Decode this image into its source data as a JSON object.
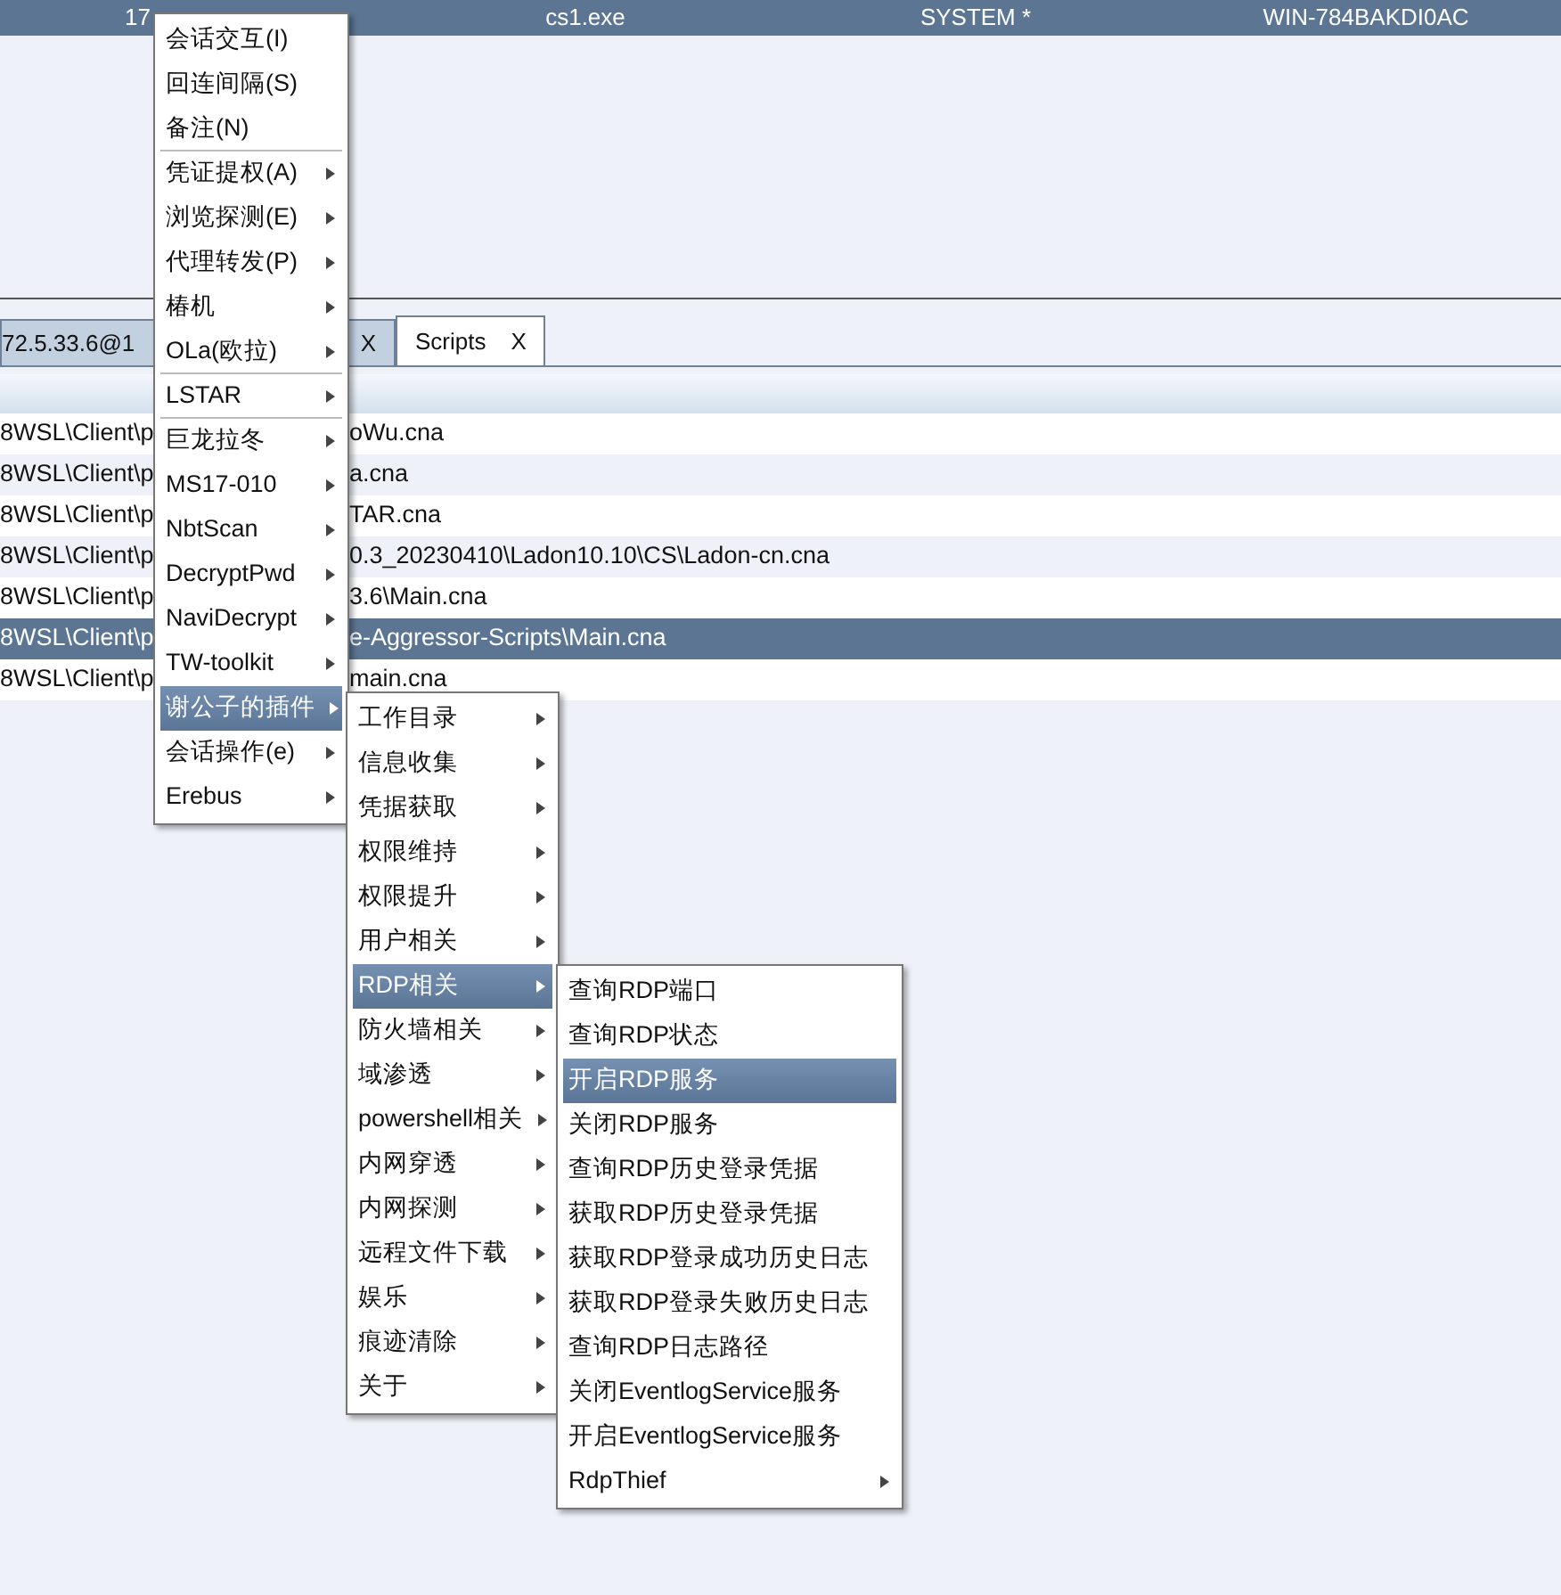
{
  "session_row": {
    "selected": true,
    "cells": [
      "17",
      "cs1.exe",
      "SYSTEM *",
      "WIN-784BAKDI0AC"
    ]
  },
  "tabs": [
    {
      "label": "72.5.33.6@1",
      "selected": false
    },
    {
      "close": "X",
      "selected": false
    },
    {
      "label": "Scripts",
      "close": "X",
      "selected": true
    }
  ],
  "scripts": [
    {
      "path_start": "8WSL\\Client\\p",
      "path_end": "oWu.cna",
      "selected": false
    },
    {
      "path_start": "8WSL\\Client\\p",
      "path_end": "a.cna",
      "selected": false
    },
    {
      "path_start": "8WSL\\Client\\p",
      "path_end": "TAR.cna",
      "selected": false
    },
    {
      "path_start": "8WSL\\Client\\p",
      "path_end": "0.3_20230410\\Ladon10.10\\CS\\Ladon-cn.cna",
      "selected": false
    },
    {
      "path_start": "8WSL\\Client\\p",
      "path_end": "3.6\\Main.cna",
      "selected": false
    },
    {
      "path_start": "8WSL\\Client\\p",
      "path_end": "e-Aggressor-Scripts\\Main.cna",
      "selected": true
    },
    {
      "path_start": "8WSL\\Client\\p",
      "path_end": "main.cna",
      "selected": false
    }
  ],
  "menus": [
    {
      "items": [
        {
          "label": "会话交互(I)",
          "submenu": false,
          "selected": false
        },
        {
          "label": "回连间隔(S)",
          "submenu": false,
          "selected": false
        },
        {
          "label": "备注(N)",
          "submenu": false,
          "selected": false,
          "separator_after": true
        },
        {
          "label": "凭证提权(A)",
          "submenu": true,
          "selected": false
        },
        {
          "label": "浏览探测(E)",
          "submenu": true,
          "selected": false
        },
        {
          "label": "代理转发(P)",
          "submenu": true,
          "selected": false
        },
        {
          "label": "椿机",
          "submenu": true,
          "selected": false
        },
        {
          "label": "OLa(欧拉)",
          "submenu": true,
          "selected": false,
          "separator_after": true
        },
        {
          "label": "LSTAR",
          "submenu": true,
          "selected": false,
          "separator_after": true
        },
        {
          "label": "巨龙拉冬",
          "submenu": true,
          "selected": false
        },
        {
          "label": "MS17-010",
          "submenu": true,
          "selected": false
        },
        {
          "label": "NbtScan",
          "submenu": true,
          "selected": false
        },
        {
          "label": "DecryptPwd",
          "submenu": true,
          "selected": false
        },
        {
          "label": "NaviDecrypt",
          "submenu": true,
          "selected": false
        },
        {
          "label": "TW-toolkit",
          "submenu": true,
          "selected": false
        },
        {
          "label": "谢公子的插件",
          "submenu": true,
          "selected": true
        },
        {
          "label": "会话操作(e)",
          "submenu": true,
          "selected": false
        },
        {
          "label": "Erebus",
          "submenu": true,
          "selected": false
        }
      ]
    },
    {
      "items": [
        {
          "label": "工作目录",
          "submenu": true,
          "selected": false
        },
        {
          "label": "信息收集",
          "submenu": true,
          "selected": false
        },
        {
          "label": "凭据获取",
          "submenu": true,
          "selected": false
        },
        {
          "label": "权限维持",
          "submenu": true,
          "selected": false
        },
        {
          "label": "权限提升",
          "submenu": true,
          "selected": false
        },
        {
          "label": "用户相关",
          "submenu": true,
          "selected": false
        },
        {
          "label": "RDP相关",
          "submenu": true,
          "selected": true
        },
        {
          "label": "防火墙相关",
          "submenu": true,
          "selected": false
        },
        {
          "label": "域渗透",
          "submenu": true,
          "selected": false
        },
        {
          "label": "powershell相关",
          "submenu": true,
          "selected": false
        },
        {
          "label": "内网穿透",
          "submenu": true,
          "selected": false
        },
        {
          "label": "内网探测",
          "submenu": true,
          "selected": false
        },
        {
          "label": "远程文件下载",
          "submenu": true,
          "selected": false
        },
        {
          "label": "娱乐",
          "submenu": true,
          "selected": false
        },
        {
          "label": "痕迹清除",
          "submenu": true,
          "selected": false
        },
        {
          "label": "关于",
          "submenu": true,
          "selected": false
        }
      ]
    },
    {
      "items": [
        {
          "label": "查询RDP端口",
          "submenu": false,
          "selected": false
        },
        {
          "label": "查询RDP状态",
          "submenu": false,
          "selected": false
        },
        {
          "label": "开启RDP服务",
          "submenu": false,
          "selected": true
        },
        {
          "label": "关闭RDP服务",
          "submenu": false,
          "selected": false
        },
        {
          "label": "查询RDP历史登录凭据",
          "submenu": false,
          "selected": false
        },
        {
          "label": "获取RDP历史登录凭据",
          "submenu": false,
          "selected": false
        },
        {
          "label": "获取RDP登录成功历史日志",
          "submenu": false,
          "selected": false
        },
        {
          "label": "获取RDP登录失败历史日志",
          "submenu": false,
          "selected": false
        },
        {
          "label": "查询RDP日志路径",
          "submenu": false,
          "selected": false
        },
        {
          "label": "关闭EventlogService服务",
          "submenu": false,
          "selected": false
        },
        {
          "label": "开启EventlogService服务",
          "submenu": false,
          "selected": false
        },
        {
          "label": "RdpThief",
          "submenu": true,
          "selected": false
        }
      ]
    }
  ]
}
